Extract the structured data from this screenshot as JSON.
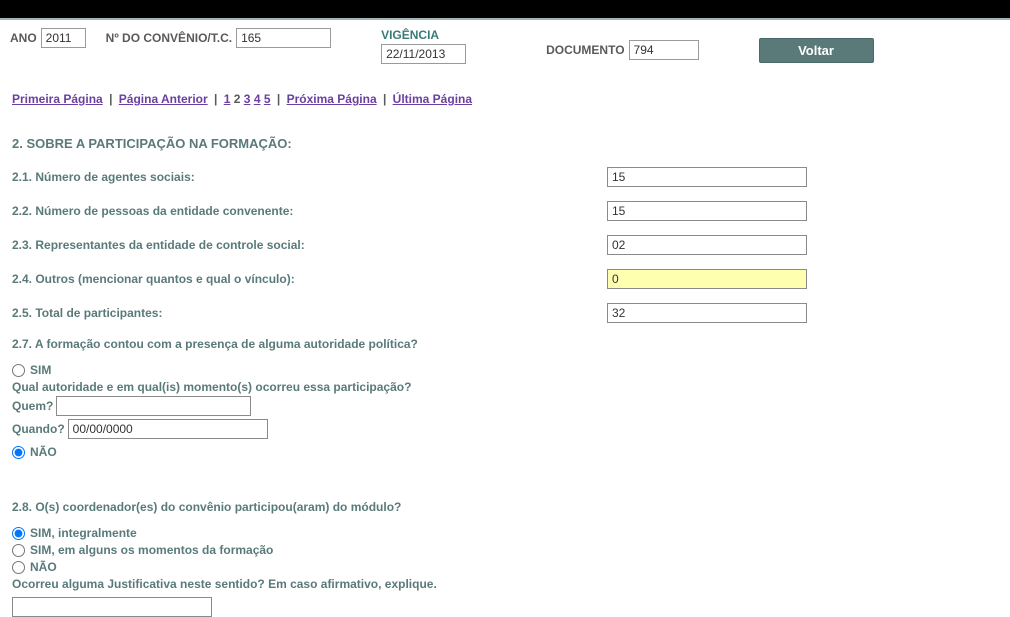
{
  "header": {
    "ano_label": "ANO",
    "ano_value": "2011",
    "convenio_label": "Nº DO CONVÊNIO/T.C.",
    "convenio_value": "165",
    "vigencia_label": "VIGÊNCIA",
    "vigencia_value": "22/11/2013",
    "documento_label": "DOCUMENTO",
    "documento_value": "794",
    "voltar_label": "Voltar"
  },
  "pagination": {
    "first": "Primeira Página",
    "prev": "Página Anterior",
    "p1": "1",
    "p2": "2",
    "p3": "3",
    "p4": "4",
    "p5": "5",
    "next": "Próxima Página",
    "last": "Última Página"
  },
  "section2": {
    "title": "2. SOBRE A PARTICIPAÇÃO NA FORMAÇÃO:",
    "f21_label": "2.1. Número de agentes sociais:",
    "f21_value": "15",
    "f22_label": "2.2. Número de pessoas da entidade convenente:",
    "f22_value": "15",
    "f23_label": "2.3. Representantes da entidade de controle social:",
    "f23_value": "02",
    "f24_label": "2.4. Outros (mencionar quantos e qual o vínculo):",
    "f24_value": "0",
    "f25_label": "2.5. Total de participantes:",
    "f25_value": "32",
    "q27_label": "2.7. A formação contou com a presença de alguma autoridade política?",
    "q27_sim": "SIM",
    "q27_sub": "Qual autoridade e em qual(is) momento(s) ocorreu essa participação?",
    "q27_quem_label": "Quem?",
    "q27_quem_value": "",
    "q27_quando_label": "Quando?",
    "q27_quando_value": "00/00/0000",
    "q27_nao": "NÃO",
    "q28_label": "2.8. O(s) coordenador(es) do convênio participou(aram) do módulo?",
    "q28_opt1": "SIM, integralmente",
    "q28_opt2": "SIM, em alguns os momentos da formação",
    "q28_opt3": "NÃO",
    "q28_sub": "Ocorreu alguma Justificativa neste sentido? Em caso afirmativo, explique.",
    "q28_justif_value": ""
  }
}
